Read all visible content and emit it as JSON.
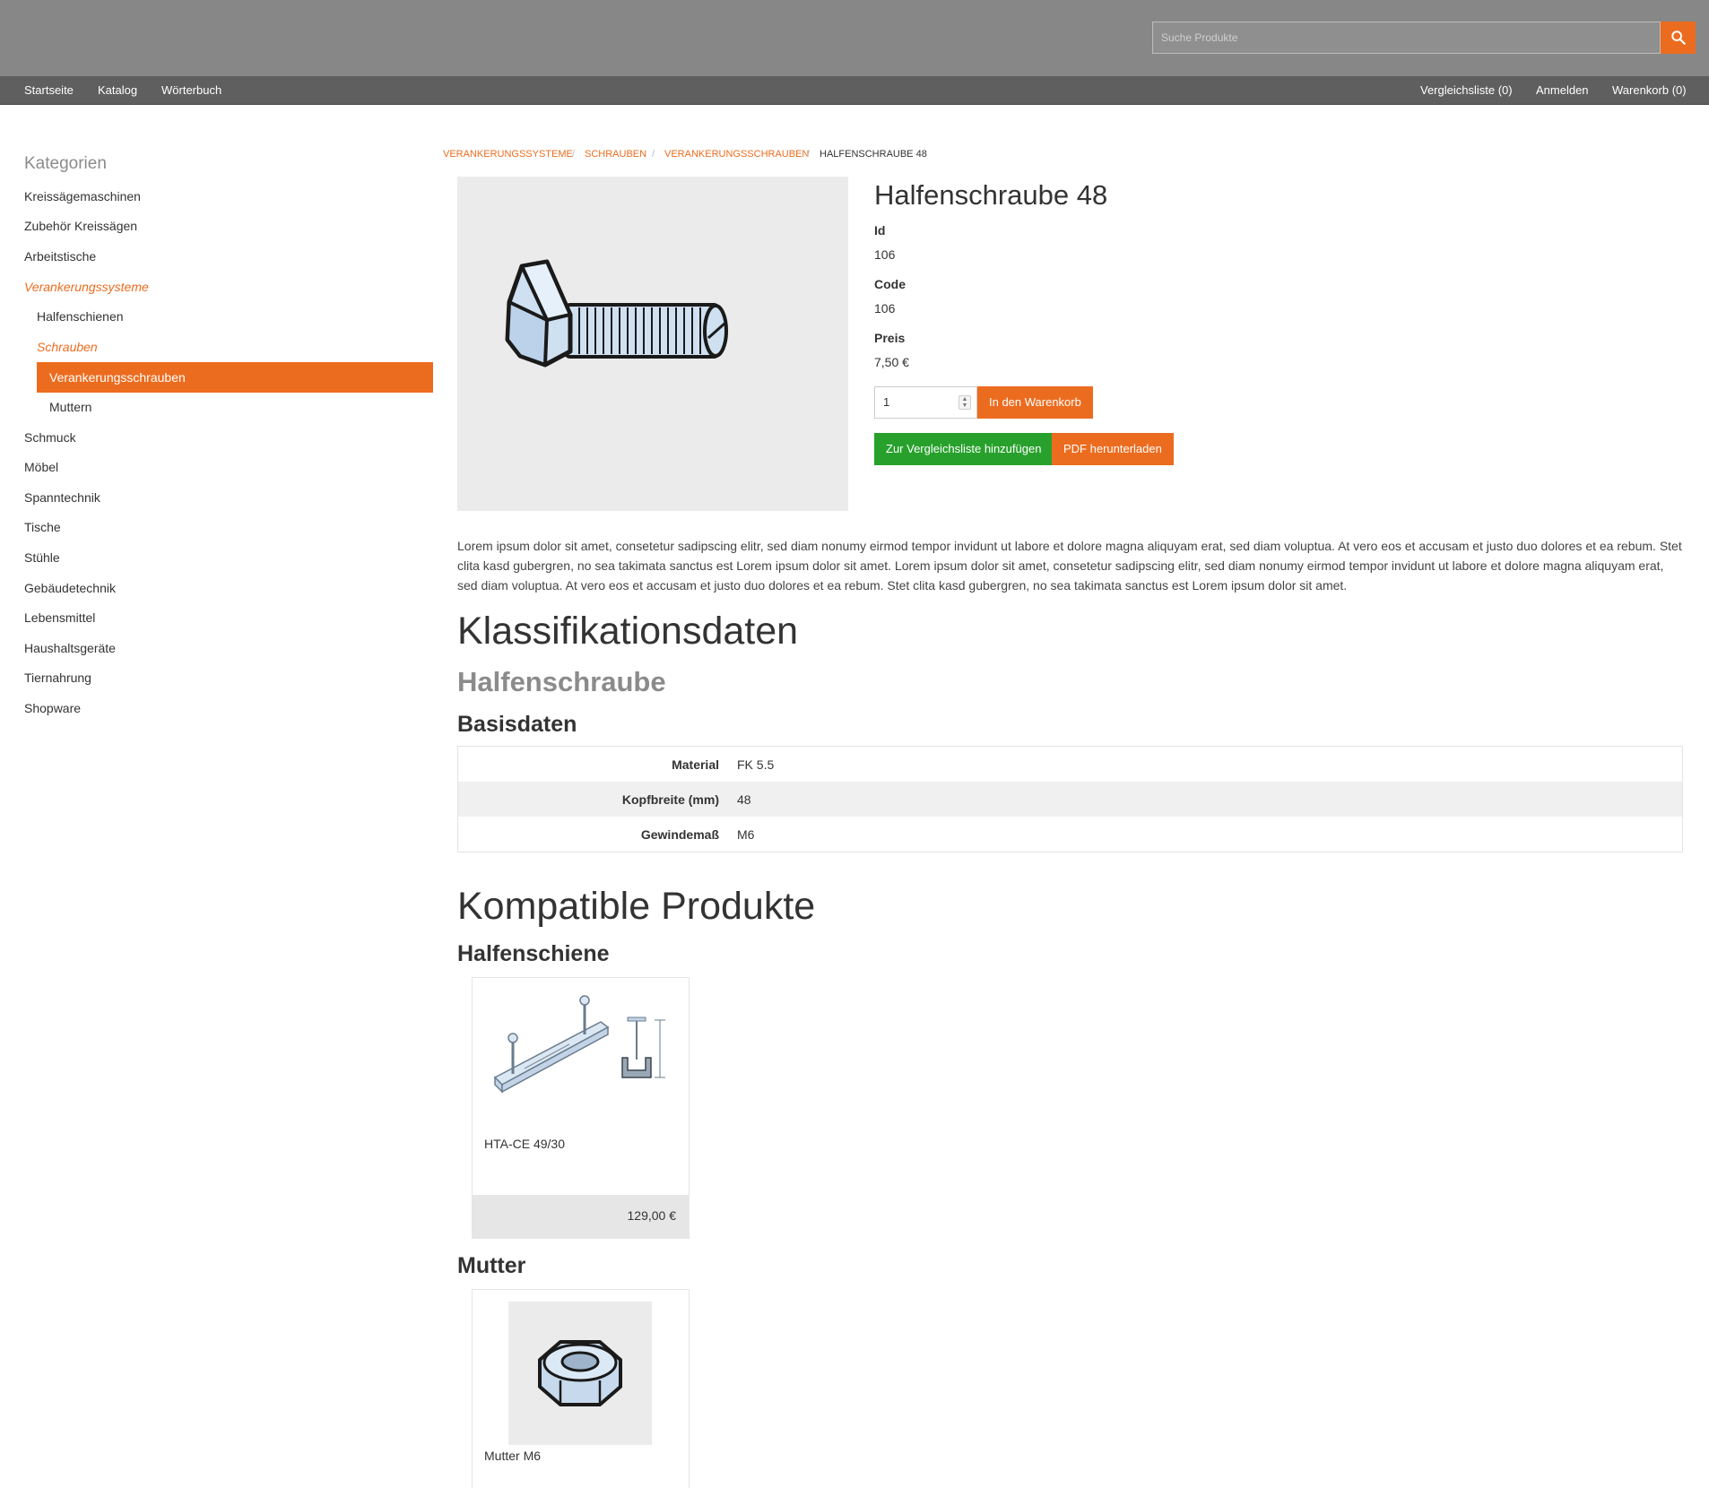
{
  "search": {
    "placeholder": "Suche Produkte",
    "icon": "search-icon"
  },
  "nav": {
    "left": [
      "Startseite",
      "Katalog",
      "Wörterbuch"
    ],
    "compare": "Vergleichsliste (0)",
    "login": "Anmelden",
    "cart": "Warenkorb (0)"
  },
  "sidebar": {
    "title": "Kategorien",
    "items": [
      "Kreissägemaschinen",
      "Zubehör Kreissägen",
      "Arbeitstische",
      "Verankerungssysteme",
      "Halfenschienen",
      "Schrauben",
      "Verankerungsschrauben",
      "Muttern",
      "Schmuck",
      "Möbel",
      "Spanntechnik",
      "Tische",
      "Stühle",
      "Gebäudetechnik",
      "Lebensmittel",
      "Haushaltsgeräte",
      "Tiernahrung",
      "Shopware"
    ]
  },
  "breadcrumb": [
    "Verankerungssysteme",
    "Schrauben",
    "Verankerungsschrauben",
    "Halfenschraube 48"
  ],
  "product": {
    "title": "Halfenschraube 48",
    "id_label": "Id",
    "id_value": "106",
    "code_label": "Code",
    "code_value": "106",
    "price_label": "Preis",
    "price_value": "7,50 €",
    "quantity": "1",
    "add_to_cart": "In den Warenkorb",
    "add_to_compare": "Zur Vergleichsliste hinzufügen",
    "download_pdf": "PDF herunterladen",
    "description": "Lorem ipsum dolor sit amet, consetetur sadipscing elitr, sed diam nonumy eirmod tempor invidunt ut labore et dolore magna aliquyam erat, sed diam voluptua. At vero eos et accusam et justo duo dolores et ea rebum. Stet clita kasd gubergren, no sea takimata sanctus est Lorem ipsum dolor sit amet. Lorem ipsum dolor sit amet, consetetur sadipscing elitr, sed diam nonumy eirmod tempor invidunt ut labore et dolore magna aliquyam erat, sed diam voluptua. At vero eos et accusam et justo duo dolores et ea rebum. Stet clita kasd gubergren, no sea takimata sanctus est Lorem ipsum dolor sit amet."
  },
  "classification": {
    "heading": "Klassifikationsdaten",
    "class_name": "Halfenschraube",
    "group": "Basisdaten",
    "rows": [
      {
        "key": "Material",
        "value": "FK 5.5"
      },
      {
        "key": "Kopfbreite (mm)",
        "value": "48"
      },
      {
        "key": "Gewindemaß",
        "value": "M6"
      }
    ]
  },
  "compatible": {
    "heading": "Kompatible Produkte",
    "groups": [
      {
        "title": "Halfenschiene",
        "product_name": "HTA-CE 49/30",
        "price": "129,00 €"
      },
      {
        "title": "Mutter",
        "product_name": "Mutter M6"
      }
    ]
  },
  "colors": {
    "accent": "#ec6c1f",
    "success": "#28a12c",
    "header": "#878787",
    "nav": "#5f5f5f"
  }
}
